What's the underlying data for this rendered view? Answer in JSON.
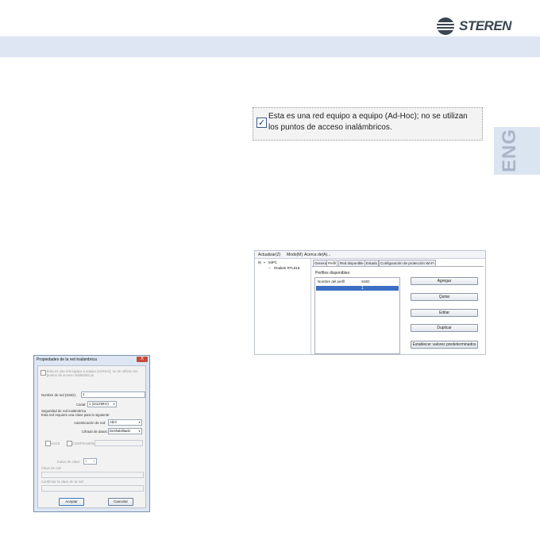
{
  "header": {
    "brand": "STEREN",
    "side_tab": "ENG",
    "band_color": "#dde6f2"
  },
  "adhoc_option": {
    "checked": true,
    "label": "Esta es una red equipo a equipo (Ad-Hoc); no se utilizan los puntos de acceso inalámbricos."
  },
  "profile_window": {
    "menu": [
      "Actualizar(Z)",
      "Modo(M)",
      "Acerca de(A)..."
    ],
    "tree": [
      "MiPC",
      "Realtek RTL818"
    ],
    "tabs": [
      "General",
      "Perfil",
      "Red disponible",
      "Estado",
      "Configuración de protección Wi-Fi"
    ],
    "active_tab": "Perfil",
    "section_label": "Perfiles disponibles",
    "columns": [
      "Nombre del perfil",
      "SSID"
    ],
    "selected_row_value": "1",
    "buttons": [
      "Agregar",
      "Quitar",
      "Editar",
      "Duplicar",
      "Establecer valores predeterminados"
    ]
  },
  "wireless_dialog": {
    "title": "Propiedades de la red inalámbrica",
    "close": "X",
    "adhoc_line1": "Esta es una red equipo a equipo (Ad-Hoc); no se utilizan los",
    "adhoc_line2": "puntos de acceso inalámbricos.",
    "ssid_label": "Nombre de red (SSID):",
    "ssid_value": "1",
    "channel_label": "Canal:",
    "channel_value": "1 (2412MHz)",
    "security_heading": "Seguridad de red inalámbrica",
    "security_desc": "Esta red requiere una clave para lo siguiente:",
    "auth_label": "Autenticación de red:",
    "auth_value": "Abrir",
    "encryption_label": "Cifrado de datos:",
    "encryption_value": "Deshabilitado",
    "ascii_label": "ASCII",
    "password_label": "CONTRASEÑA",
    "key_index_label": "Índice de clave",
    "key_index_value": "1",
    "network_key_label": "Clave de red:",
    "confirm_key_label": "Confirmar la clave de la red:",
    "ok_button": "Aceptar",
    "cancel_button": "Cancelar"
  }
}
